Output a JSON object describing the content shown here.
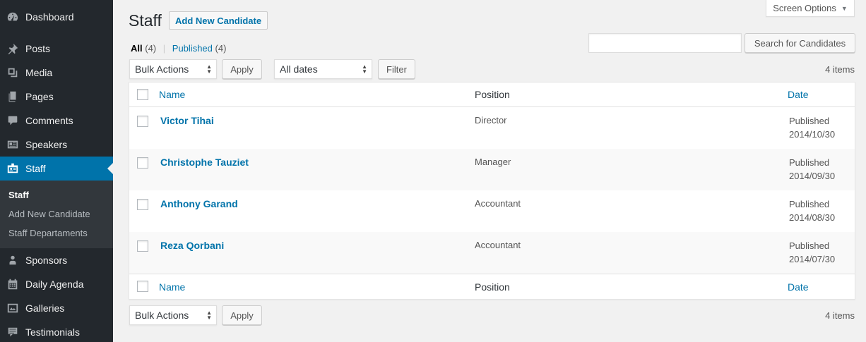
{
  "sidebar": {
    "items": [
      {
        "label": "Dashboard",
        "icon": "dashboard-icon"
      },
      {
        "label": "Posts",
        "icon": "pushpin-icon"
      },
      {
        "label": "Media",
        "icon": "media-icon"
      },
      {
        "label": "Pages",
        "icon": "pages-icon"
      },
      {
        "label": "Comments",
        "icon": "comment-icon"
      },
      {
        "label": "Speakers",
        "icon": "id-card-icon"
      },
      {
        "label": "Staff",
        "icon": "id-badge-icon"
      }
    ],
    "submenu": [
      "Staff",
      "Add New Candidate",
      "Staff Departaments"
    ],
    "items_after": [
      {
        "label": "Sponsors",
        "icon": "person-icon"
      },
      {
        "label": "Daily Agenda",
        "icon": "calendar-icon"
      },
      {
        "label": "Galleries",
        "icon": "gallery-icon"
      },
      {
        "label": "Testimonials",
        "icon": "testimonial-icon"
      }
    ],
    "accent": "#0073aa"
  },
  "header": {
    "screen_options": "Screen Options",
    "title": "Staff",
    "add_new": "Add New Candidate"
  },
  "filters": {
    "all_label": "All",
    "all_count": "(4)",
    "separator": "|",
    "published_label": "Published",
    "published_count": "(4)"
  },
  "search": {
    "value": "",
    "button": "Search for Candidates"
  },
  "tablenav_top": {
    "bulk_actions": "Bulk Actions",
    "apply": "Apply",
    "dates": "All dates",
    "filter": "Filter",
    "items": "4 items"
  },
  "table": {
    "columns": {
      "name": "Name",
      "position": "Position",
      "date": "Date"
    },
    "rows": [
      {
        "name": "Victor Tihai",
        "position": "Director",
        "status": "Published",
        "date": "2014/10/30"
      },
      {
        "name": "Christophe Tauziet",
        "position": "Manager",
        "status": "Published",
        "date": "2014/09/30"
      },
      {
        "name": "Anthony Garand",
        "position": "Accountant",
        "status": "Published",
        "date": "2014/08/30"
      },
      {
        "name": "Reza Qorbani",
        "position": "Accountant",
        "status": "Published",
        "date": "2014/07/30"
      }
    ]
  },
  "tablenav_bottom": {
    "bulk_actions": "Bulk Actions",
    "apply": "Apply",
    "items": "4 items"
  }
}
